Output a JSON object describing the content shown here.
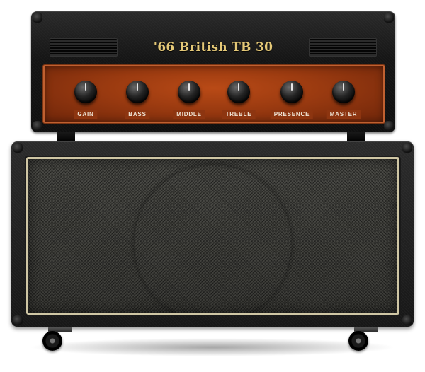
{
  "amp": {
    "title": "'66 British TB 30",
    "knobs": [
      {
        "label": "GAIN"
      },
      {
        "label": "BASS"
      },
      {
        "label": "MIDDLE"
      },
      {
        "label": "TREBLE"
      },
      {
        "label": "PRESENCE"
      },
      {
        "label": "MASTER"
      }
    ]
  },
  "colors": {
    "panel": "#9a3a10",
    "title_gold": "#e4c877",
    "grill_frame": "#cfc6a4",
    "tolex": "#171717"
  }
}
